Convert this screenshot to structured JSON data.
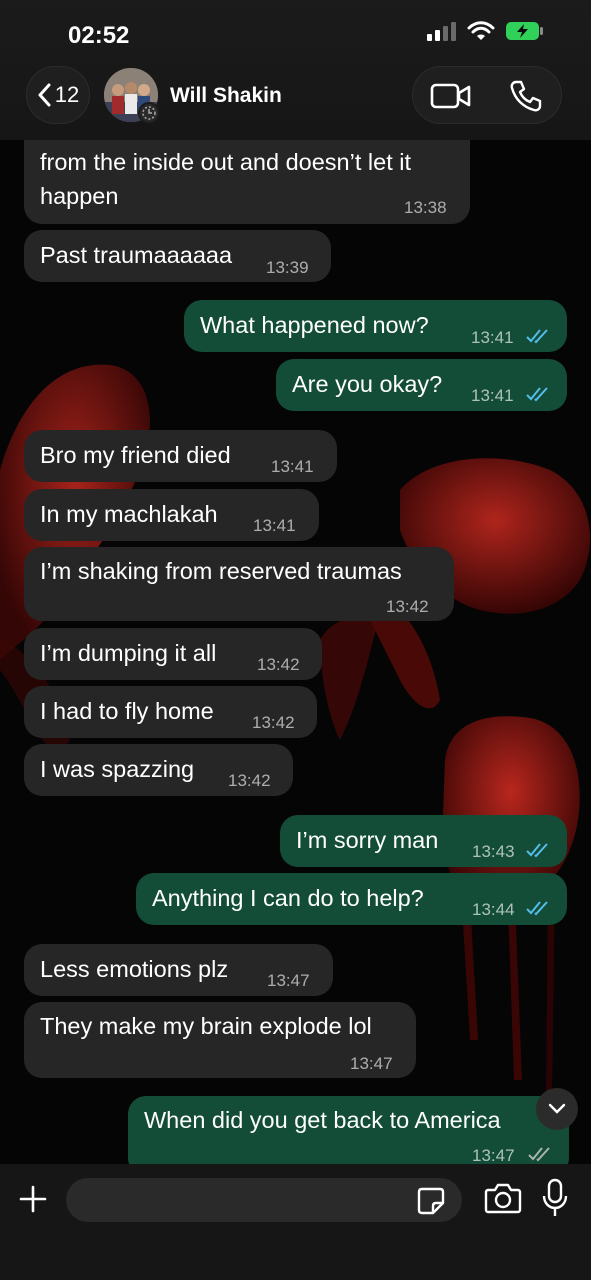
{
  "status_bar": {
    "time": "02:52"
  },
  "header": {
    "back_count": "12",
    "contact_name": "Will Shakin"
  },
  "messages": [
    {
      "dir": "in",
      "text_lines": [
        "from the inside out and doesn’t let it",
        "happen"
      ],
      "time": "13:38"
    },
    {
      "dir": "in",
      "text": "Past traumaaaaaa",
      "time": "13:39"
    },
    {
      "dir": "out",
      "text": "What happened now?",
      "time": "13:41",
      "read": true
    },
    {
      "dir": "out",
      "text": "Are you okay?",
      "time": "13:41",
      "read": true
    },
    {
      "dir": "in",
      "text": "Bro my friend died",
      "time": "13:41"
    },
    {
      "dir": "in",
      "text": "In my machlakah",
      "time": "13:41"
    },
    {
      "dir": "in",
      "text": "I’m shaking from reserved traumas",
      "time": "13:42"
    },
    {
      "dir": "in",
      "text": "I’m dumping it all",
      "time": "13:42"
    },
    {
      "dir": "in",
      "text": "I had to fly home",
      "time": "13:42"
    },
    {
      "dir": "in",
      "text": "I was spazzing",
      "time": "13:42"
    },
    {
      "dir": "out",
      "text": "I’m sorry man",
      "time": "13:43",
      "read": true
    },
    {
      "dir": "out",
      "text": "Anything I can do to help?",
      "time": "13:44",
      "read": true
    },
    {
      "dir": "in",
      "text": "Less emotions plz",
      "time": "13:47"
    },
    {
      "dir": "in",
      "text": "They make my brain explode lol",
      "time": "13:47"
    },
    {
      "dir": "out",
      "text": "When did you get back to America",
      "time": "13:47",
      "read": false
    }
  ],
  "input": {
    "placeholder": ""
  },
  "colors": {
    "incoming_bubble": "#262626",
    "outgoing_bubble": "#134d37",
    "read_ticks": "#53bdeb",
    "battery_charging": "#30d158"
  },
  "icons": [
    "chevron-left-icon",
    "video-call-icon",
    "phone-icon",
    "plus-icon",
    "sticker-icon",
    "camera-icon",
    "microphone-icon",
    "chevron-down-icon",
    "double-check-icon",
    "signal-icon",
    "wifi-icon",
    "battery-charging-icon"
  ]
}
